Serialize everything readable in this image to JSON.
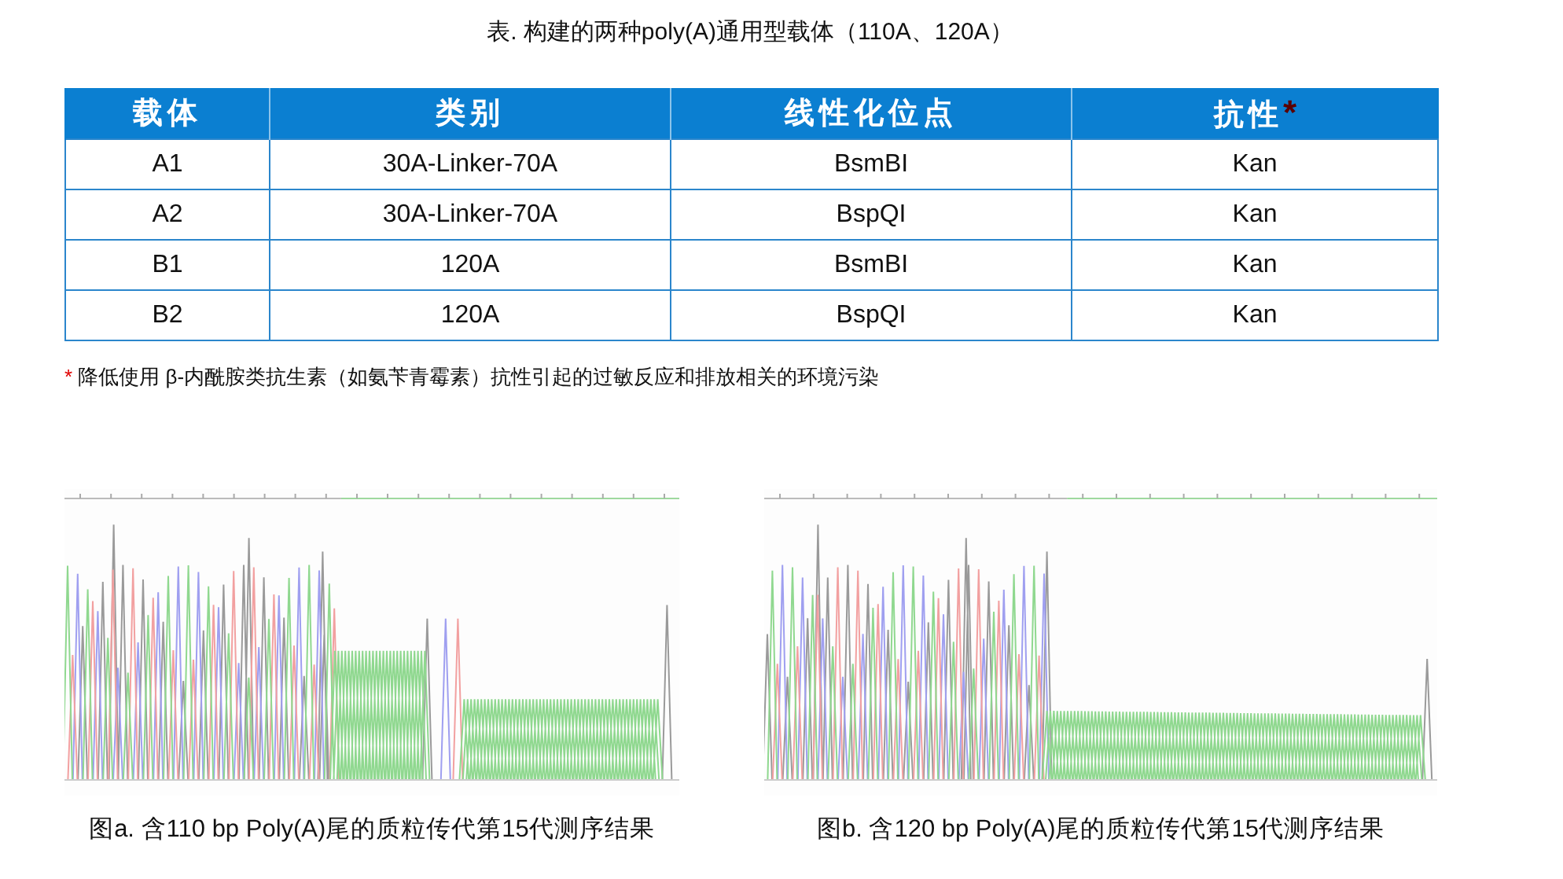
{
  "table_title": "表. 构建的两种poly(A)通用型载体（110A、120A）",
  "table": {
    "columns": [
      {
        "label": "载体"
      },
      {
        "label": "类别"
      },
      {
        "label": "线性化位点"
      },
      {
        "label": "抗性",
        "mark": "*"
      }
    ],
    "rows": [
      [
        "A1",
        "30A-Linker-70A",
        "BsmBI",
        "Kan"
      ],
      [
        "A2",
        "30A-Linker-70A",
        "BspQI",
        "Kan"
      ],
      [
        "B1",
        "120A",
        "BsmBI",
        "Kan"
      ],
      [
        "B2",
        "120A",
        "BspQI",
        "Kan"
      ]
    ]
  },
  "footnote": {
    "mark": "*",
    "text": "降低使用 β-内酰胺类抗生素（如氨苄青霉素）抗性引起的过敏反应和排放相关的环境污染"
  },
  "figures": [
    {
      "kind": "chromatogram",
      "caption": "图a. 含110 bp Poly(A)尾的质粒传代第15代测序结果"
    },
    {
      "kind": "chromatogram",
      "caption": "图b. 含120 bp Poly(A)尾的质粒传代第15代测序结果"
    }
  ]
}
